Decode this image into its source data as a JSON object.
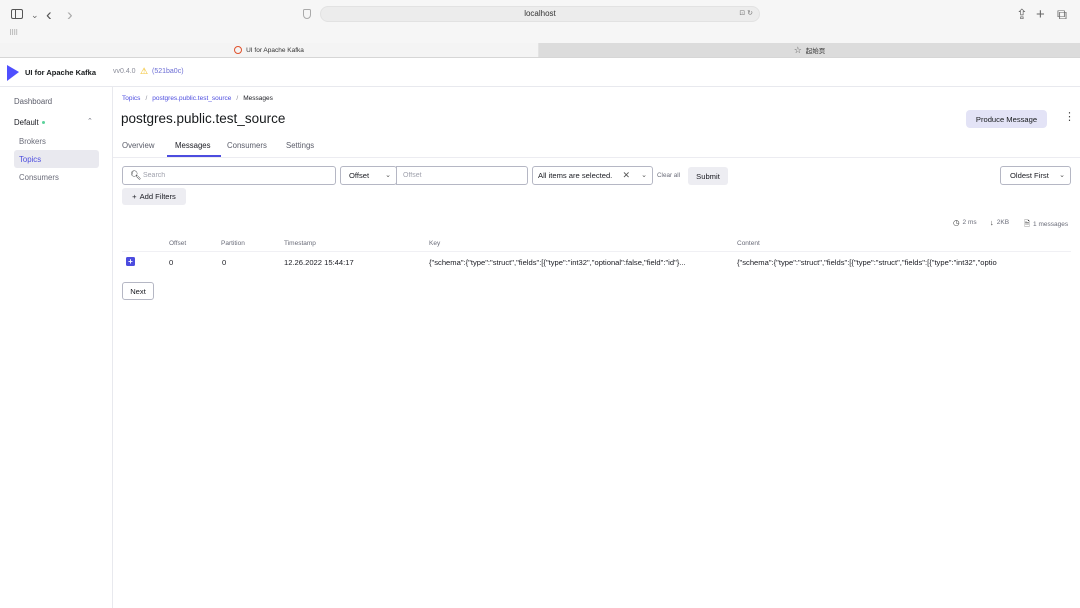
{
  "browser": {
    "url": "localhost",
    "tabs": [
      {
        "label": "UI for Apache Kafka"
      },
      {
        "label": "起始页"
      }
    ]
  },
  "app": {
    "name": "UI for Apache Kafka",
    "version": "vv0.4.0",
    "commit": "(521ba0c)"
  },
  "sidebar": {
    "dashboard": "Dashboard",
    "cluster": "Default",
    "items": [
      {
        "label": "Brokers"
      },
      {
        "label": "Topics"
      },
      {
        "label": "Consumers"
      }
    ]
  },
  "breadcrumb": {
    "topics": "Topics",
    "topic": "postgres.public.test_source",
    "current": "Messages",
    "sep": "/"
  },
  "page": {
    "title": "postgres.public.test_source",
    "produce_label": "Produce Message"
  },
  "tabs": [
    {
      "label": "Overview"
    },
    {
      "label": "Messages"
    },
    {
      "label": "Consumers"
    },
    {
      "label": "Settings"
    }
  ],
  "filters": {
    "search_placeholder": "Search",
    "seek_type": "Offset",
    "offset_placeholder": "Offset",
    "partitions": "All items are selected.",
    "clear_all": "Clear all",
    "submit": "Submit",
    "sort": "Oldest First",
    "add_filters": "Add Filters"
  },
  "stats": {
    "time": "2 ms",
    "size": "2KB",
    "messages": "1 messages"
  },
  "table": {
    "headers": [
      "Offset",
      "Partition",
      "Timestamp",
      "Key",
      "Content"
    ],
    "rows": [
      {
        "offset": "0",
        "partition": "0",
        "timestamp": "12.26.2022 15:44:17",
        "key": "{\"schema\":{\"type\":\"struct\",\"fields\":[{\"type\":\"int32\",\"optional\":false,\"field\":\"id\"}...",
        "content": "{\"schema\":{\"type\":\"struct\",\"fields\":[{\"type\":\"struct\",\"fields\":[{\"type\":\"int32\",\"optio"
      }
    ]
  },
  "pagination": {
    "next": "Next"
  }
}
